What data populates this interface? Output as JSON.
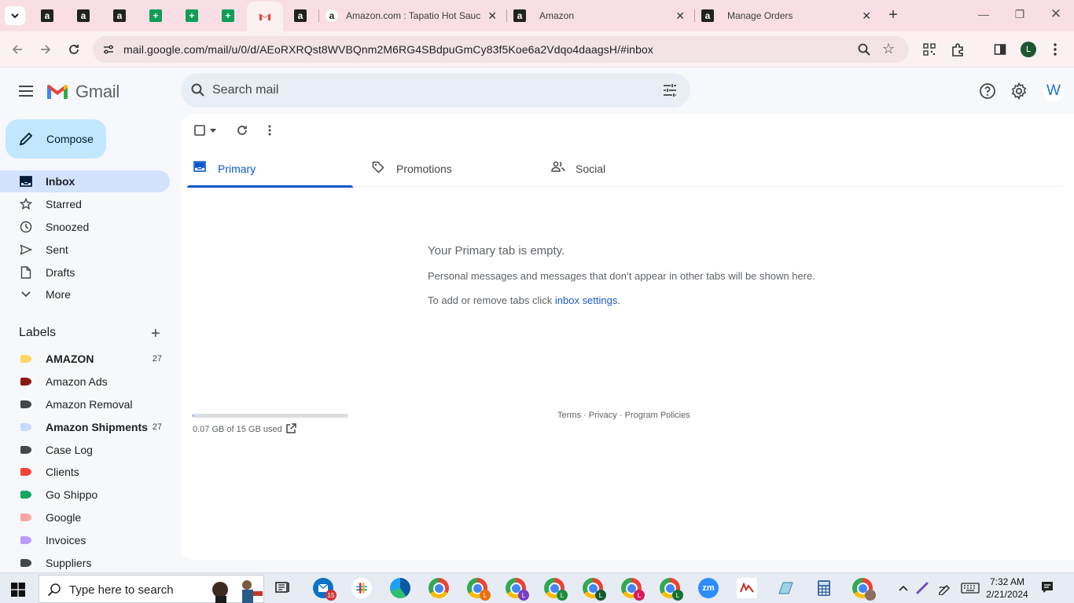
{
  "browser": {
    "tabs": [
      {
        "title": "Amazon.com : Tapatio Hot Sauc"
      },
      {
        "title": "Amazon"
      },
      {
        "title": "Manage Orders"
      }
    ],
    "url": "mail.google.com/mail/u/0/d/AEoRXRQst8WVBQnm2M6RG4SBdpuGmCy83f5Koe6a2Vdqo4daagsH/#inbox",
    "profile_initial": "L"
  },
  "gmail": {
    "product_name": "Gmail",
    "search_placeholder": "Search mail",
    "avatar_initial": "W",
    "compose_label": "Compose",
    "nav": [
      {
        "label": "Inbox"
      },
      {
        "label": "Starred"
      },
      {
        "label": "Snoozed"
      },
      {
        "label": "Sent"
      },
      {
        "label": "Drafts"
      },
      {
        "label": "More"
      }
    ],
    "labels_heading": "Labels",
    "labels": [
      {
        "name": "AMAZON",
        "count": "27",
        "color": "#fdd663"
      },
      {
        "name": "Amazon Ads",
        "count": "",
        "color": "#8c1a11"
      },
      {
        "name": "Amazon Removal",
        "count": "",
        "color": "#444746"
      },
      {
        "name": "Amazon Shipments",
        "count": "27",
        "color": "#c6dafc"
      },
      {
        "name": "Case Log",
        "count": "",
        "color": "#444746"
      },
      {
        "name": "Clients",
        "count": "",
        "color": "#f44336"
      },
      {
        "name": "Go Shippo",
        "count": "",
        "color": "#16a765"
      },
      {
        "name": "Google",
        "count": "",
        "color": "#f6a6a0"
      },
      {
        "name": "Invoices",
        "count": "",
        "color": "#b99aff"
      },
      {
        "name": "Suppliers",
        "count": "",
        "color": "#444746"
      }
    ],
    "category_tabs": [
      {
        "label": "Primary"
      },
      {
        "label": "Promotions"
      },
      {
        "label": "Social"
      }
    ],
    "empty": {
      "title": "Your Primary tab is empty.",
      "line1": "Personal messages and messages that don’t appear in other tabs will be shown here.",
      "line2_prefix": "To add or remove tabs click ",
      "line2_link": "inbox settings",
      "line2_suffix": "."
    },
    "storage": {
      "text": "0.07 GB of 15 GB used",
      "fraction": 0.005
    },
    "footer": {
      "terms": "Terms",
      "privacy": "Privacy",
      "policies": "Program Policies",
      "sep": " · "
    }
  },
  "taskbar": {
    "search_placeholder": "Type here to search",
    "mail_badge": "15",
    "time": "7:32 AM",
    "date": "2/21/2024",
    "zoom_label": "zm"
  }
}
